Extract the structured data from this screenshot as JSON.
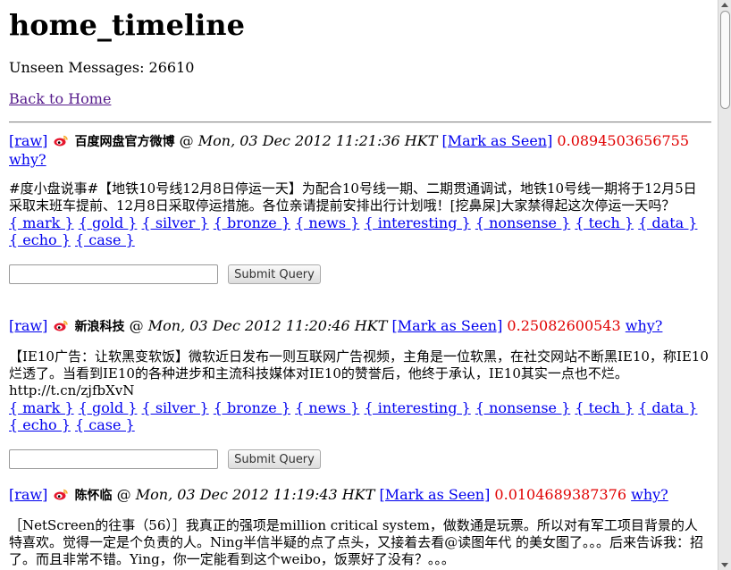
{
  "page": {
    "title": "home_timeline",
    "unseen": "Unseen Messages: 26610",
    "back_link": "Back to Home"
  },
  "labels": {
    "raw": "[raw]",
    "mark_seen": "[Mark as Seen]",
    "why": "why?",
    "at": "@",
    "submit": "Submit Query"
  },
  "tags": [
    "{ mark }",
    "{ gold }",
    "{ silver }",
    "{ bronze }",
    "{ news }",
    "{ interesting }",
    "{ nonsense }",
    "{ tech }",
    "{ data }",
    "{ echo }",
    "{ case }"
  ],
  "posts": [
    {
      "author": "百度网盘官方微博",
      "date": "Mon, 03 Dec 2012 11:21:36 HKT",
      "score": "0.0894503656755",
      "text": "#度小盘说事#【地铁10号线12月8日停运一天】为配合10号线一期、二期贯通调试，地铁10号线一期将于12月5日采取末班车提前、12月8日采取停运措施。各位亲请提前安排出行计划哦！[挖鼻屎]大家禁得起这次停运一天吗？",
      "input_value": ""
    },
    {
      "author": "新浪科技",
      "date": "Mon, 03 Dec 2012 11:20:46 HKT",
      "score": "0.25082600543",
      "text": "【IE10广告：让软黑变软饭】微软近日发布一则互联网广告视频，主角是一位软黑，在社交网站不断黑IE10，称IE10烂透了。当看到IE10的各种进步和主流科技媒体对IE10的赞誉后，他终于承认，IE10其实一点也不烂。http://t.cn/zjfbXvN",
      "input_value": ""
    },
    {
      "author": "陈怀临",
      "date": "Mon, 03 Dec 2012 11:19:43 HKT",
      "score": "0.0104689387376",
      "text": "［NetScreen的往事（56）］我真正的强项是million critical system，做数通是玩票。所以对有军工项目背景的人特喜欢。觉得一定是个负责的人。Ning半信半疑的点了点头，又接着去看@读图年代 的美女图了。。。后来告诉我：招了。而且非常不错。Ying，你一定能看到这个weibo，饭票好了没有？。。。",
      "input_value": ""
    }
  ],
  "colors": {
    "link": "#0000ee",
    "visited_link": "#551a8b",
    "score": "#e00000"
  },
  "icons": [
    "weibo-icon"
  ]
}
